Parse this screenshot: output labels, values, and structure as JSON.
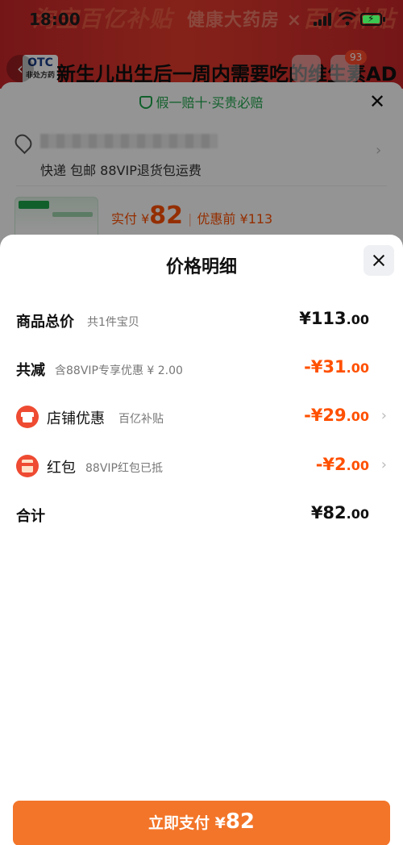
{
  "status_bar": {
    "time": "18:00"
  },
  "background_page": {
    "banner": {
      "text_left": "淘宝百亿补贴",
      "text_middle": "健康大药房 ×",
      "text_right": "百亿补贴"
    },
    "header": {
      "logo_text": "OTC",
      "logo_sub": "非处方药",
      "title": "新生儿出生后一周内需要吃的维生素AD",
      "cart_badge": "93"
    },
    "sheet": {
      "guarantee_text": "假一赔十·买贵必赔",
      "shipping_text": "快递 包邮 88VIP退货包运费",
      "price_prefix": "实付 ¥",
      "price_value": "82",
      "price_before": "优惠前 ¥113"
    }
  },
  "price_sheet": {
    "title": "价格明细",
    "rows": [
      {
        "label": "商品总价",
        "sub": "共1件宝贝",
        "value_main": "¥113",
        "value_cents": ".00"
      },
      {
        "label": "共减",
        "sub": "含88VIP专享优惠 ¥ 2.00",
        "value_main": "-¥31",
        "value_cents": ".00"
      },
      {
        "label": "店铺优惠",
        "sub": "百亿补贴",
        "value_main": "-¥29",
        "value_cents": ".00"
      },
      {
        "label": "红包",
        "sub": "88VIP红包已抵",
        "value_main": "-¥2",
        "value_cents": ".00"
      },
      {
        "label": "合计",
        "sub": "",
        "value_main": "¥82",
        "value_cents": ".00"
      }
    ],
    "chevron": "›"
  },
  "pay_button": {
    "label": "立即支付 ¥",
    "amount": "82"
  },
  "colors": {
    "accent": "#ff5000",
    "pay_button": "#f37529",
    "guarantee_green": "#1ea54b",
    "icon_red": "#ee4b32"
  },
  "icons": [
    "back-icon",
    "share-icon",
    "cart-icon",
    "shield-icon",
    "location-icon",
    "close-icon",
    "store-icon",
    "red-envelope-icon",
    "chevron-right-icon"
  ]
}
